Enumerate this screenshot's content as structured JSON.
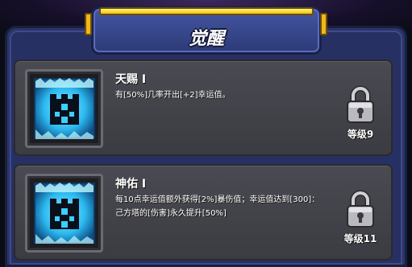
{
  "header": {
    "title": "觉醒"
  },
  "awakenings": [
    {
      "name": "天赐 Ⅰ",
      "description": "有[50%]几率开出[+2]幸运值。",
      "level_label": "等级9",
      "icon": "castle-tower-icon",
      "locked": true
    },
    {
      "name": "神佑 Ⅰ",
      "description": "每10点幸运值额外获得[2%]暴伤值；幸运值达到[300]：己方塔的[伤害]永久提升[50%]",
      "level_label": "等级11",
      "icon": "castle-tower-icon",
      "locked": true
    }
  ],
  "colors": {
    "panel": "#2b3569",
    "card": "#44444b",
    "accent_bar": "#f2c214",
    "icon_glow": "#3ad0ff"
  }
}
